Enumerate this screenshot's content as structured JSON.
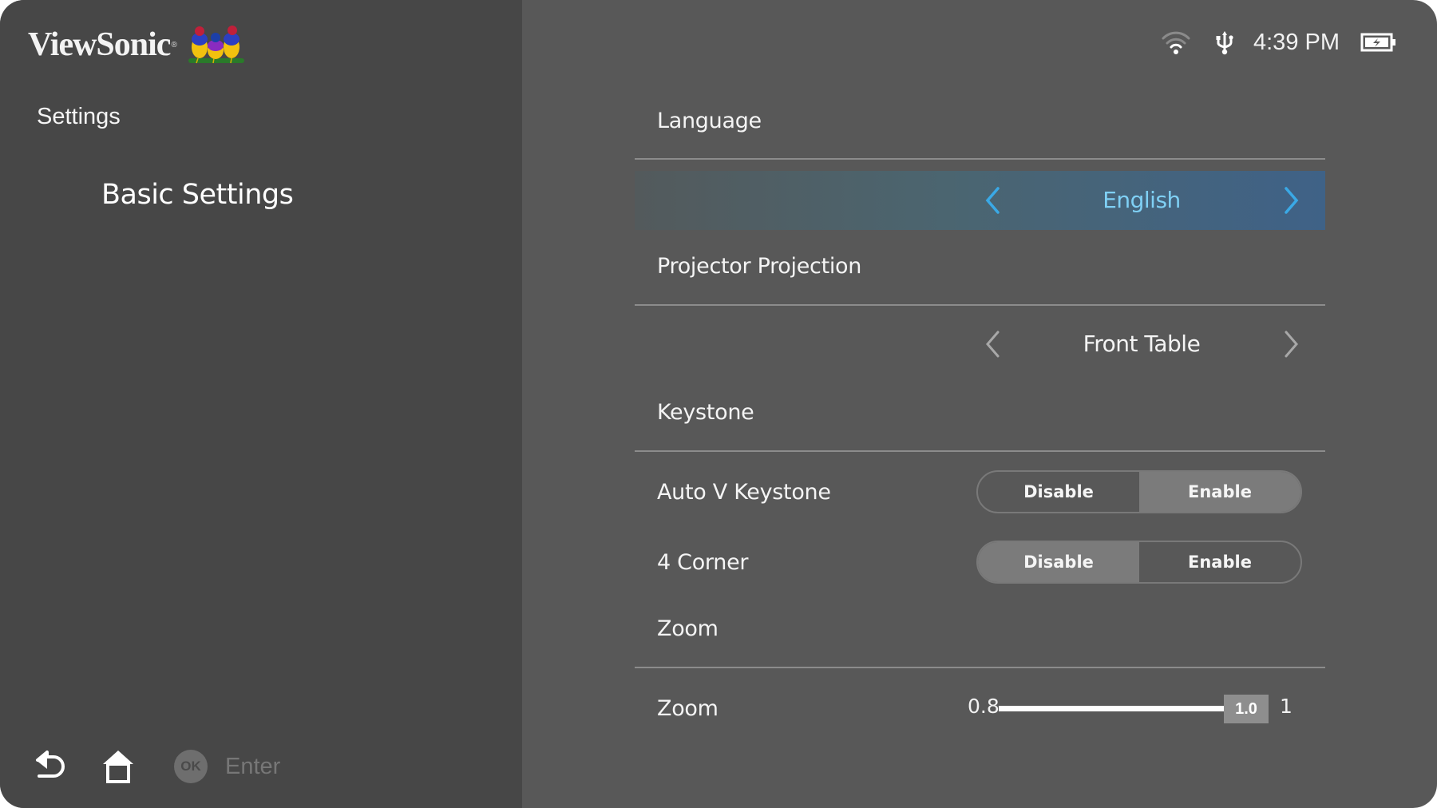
{
  "brand": {
    "name": "ViewSonic",
    "registered_mark": "®",
    "logo_icon": "viewsonic-birds-logo"
  },
  "status_bar": {
    "wifi_icon": "wifi-icon",
    "usb_icon": "usb-icon",
    "time": "4:39 PM",
    "battery_icon": "battery-charging-icon"
  },
  "sidebar": {
    "title": "Settings",
    "subtitle": "Basic Settings",
    "footer": {
      "back_icon": "back-icon",
      "home_icon": "home-icon",
      "ok_badge": "OK",
      "ok_action": "Enter"
    }
  },
  "settings": {
    "language": {
      "label": "Language",
      "value": "English",
      "focused": true,
      "accent_color": "#4cb4ec"
    },
    "projection": {
      "label": "Projector Projection",
      "value": "Front Table"
    },
    "keystone": {
      "label": "Keystone",
      "auto_v": {
        "label": "Auto V Keystone",
        "options": [
          "Disable",
          "Enable"
        ],
        "selected": "Enable"
      },
      "four_corner": {
        "label": "4 Corner",
        "options": [
          "Disable",
          "Enable"
        ],
        "selected": "Disable"
      }
    },
    "zoom": {
      "label": "Zoom",
      "row_label": "Zoom",
      "min_label": "0.8",
      "max_label": "1",
      "min": 0.8,
      "max": 1.0,
      "value": 1.0,
      "value_label": "1.0"
    }
  }
}
